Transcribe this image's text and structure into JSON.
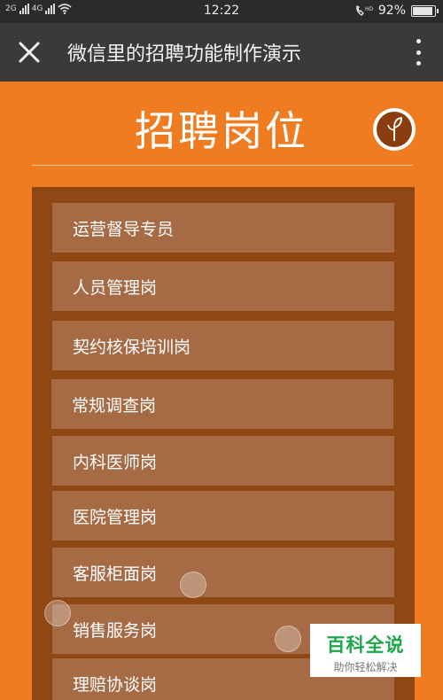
{
  "status_bar": {
    "sim1": "2G",
    "sim2": "4G",
    "time": "12:22",
    "battery": "92%",
    "battery_level": 0.92
  },
  "title_bar": {
    "title": "微信里的招聘功能制作演示"
  },
  "page": {
    "heading": "招聘岗位"
  },
  "jobs": [
    "运营督导专员",
    "人员管理岗",
    "契约核保培训岗",
    "常规调查岗",
    "内科医师岗",
    "医院管理岗",
    "客服柜面岗",
    "销售服务岗",
    "理赔协谈岗"
  ],
  "watermark": {
    "title": "百科全说",
    "subtitle": "助你轻松解决"
  },
  "colors": {
    "background": "#F07C21",
    "panel": "#8F4714",
    "item": "#A66B45",
    "title_bar": "#3A3A3A"
  }
}
